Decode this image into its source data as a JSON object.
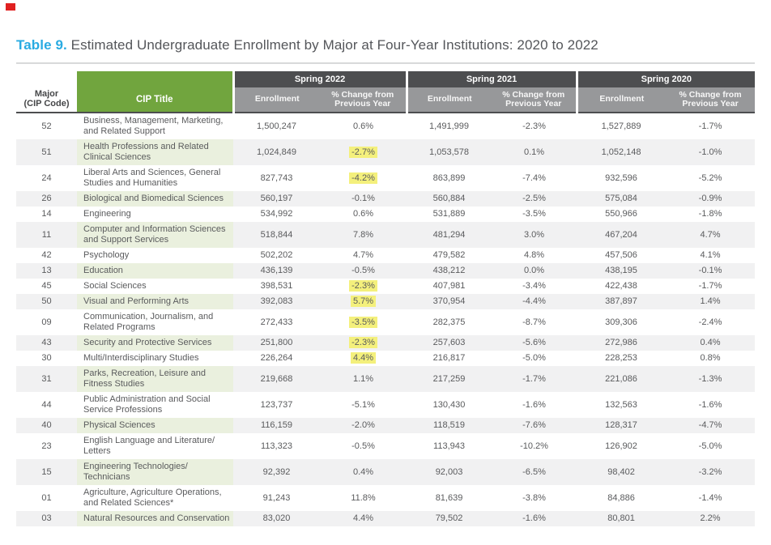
{
  "marker": {
    "color": "#e02020"
  },
  "title": {
    "prefix": "Table 9.",
    "text": " Estimated Undergraduate Enrollment by Major at Four-Year Institutions: 2020 to 2022"
  },
  "colors": {
    "accent_blue": "#29abe2",
    "header_green": "#71a53e",
    "band_dark_gray": "#4d4e50",
    "band_mid_gray": "#97989a",
    "row_tint_gray": "#f1f1f2",
    "row_tint_green": "#eaf0de",
    "highlight_yellow": "#f4f07c"
  },
  "table": {
    "headers": {
      "major_line1": "Major",
      "major_line2": "(CIP Code)",
      "cip_title": "CIP Title",
      "groups": [
        {
          "label": "Spring 2022"
        },
        {
          "label": "Spring 2021"
        },
        {
          "label": "Spring 2020"
        }
      ],
      "enrollment": "Enrollment",
      "pct_change_line1": "% Change from",
      "pct_change_line2": "Previous Year"
    },
    "rows": [
      {
        "code": "52",
        "title": "Business, Management, Marketing, and Related Support",
        "s2022": {
          "enrollment": "1,500,247",
          "change": "0.6%",
          "highlight": false
        },
        "s2021": {
          "enrollment": "1,491,999",
          "change": "-2.3%"
        },
        "s2020": {
          "enrollment": "1,527,889",
          "change": "-1.7%"
        }
      },
      {
        "code": "51",
        "title": "Health Professions and Related Clinical Sciences",
        "s2022": {
          "enrollment": "1,024,849",
          "change": "-2.7%",
          "highlight": true
        },
        "s2021": {
          "enrollment": "1,053,578",
          "change": "0.1%"
        },
        "s2020": {
          "enrollment": "1,052,148",
          "change": "-1.0%"
        }
      },
      {
        "code": "24",
        "title": "Liberal Arts and Sciences, General Studies and Humanities",
        "s2022": {
          "enrollment": "827,743",
          "change": "-4.2%",
          "highlight": true
        },
        "s2021": {
          "enrollment": "863,899",
          "change": "-7.4%"
        },
        "s2020": {
          "enrollment": "932,596",
          "change": "-5.2%"
        }
      },
      {
        "code": "26",
        "title": "Biological and Biomedical Sciences",
        "s2022": {
          "enrollment": "560,197",
          "change": "-0.1%",
          "highlight": false
        },
        "s2021": {
          "enrollment": "560,884",
          "change": "-2.5%"
        },
        "s2020": {
          "enrollment": "575,084",
          "change": "-0.9%"
        }
      },
      {
        "code": "14",
        "title": "Engineering",
        "s2022": {
          "enrollment": "534,992",
          "change": "0.6%",
          "highlight": false
        },
        "s2021": {
          "enrollment": "531,889",
          "change": "-3.5%"
        },
        "s2020": {
          "enrollment": "550,966",
          "change": "-1.8%"
        }
      },
      {
        "code": "11",
        "title": "Computer and Information Sciences and Support Services",
        "s2022": {
          "enrollment": "518,844",
          "change": "7.8%",
          "highlight": false
        },
        "s2021": {
          "enrollment": "481,294",
          "change": "3.0%"
        },
        "s2020": {
          "enrollment": "467,204",
          "change": "4.7%"
        }
      },
      {
        "code": "42",
        "title": "Psychology",
        "s2022": {
          "enrollment": "502,202",
          "change": "4.7%",
          "highlight": false
        },
        "s2021": {
          "enrollment": "479,582",
          "change": "4.8%"
        },
        "s2020": {
          "enrollment": "457,506",
          "change": "4.1%"
        }
      },
      {
        "code": "13",
        "title": "Education",
        "s2022": {
          "enrollment": "436,139",
          "change": "-0.5%",
          "highlight": false
        },
        "s2021": {
          "enrollment": "438,212",
          "change": "0.0%"
        },
        "s2020": {
          "enrollment": "438,195",
          "change": "-0.1%"
        }
      },
      {
        "code": "45",
        "title": "Social Sciences",
        "s2022": {
          "enrollment": "398,531",
          "change": "-2.3%",
          "highlight": true
        },
        "s2021": {
          "enrollment": "407,981",
          "change": "-3.4%"
        },
        "s2020": {
          "enrollment": "422,438",
          "change": "-1.7%"
        }
      },
      {
        "code": "50",
        "title": "Visual and Performing Arts",
        "s2022": {
          "enrollment": "392,083",
          "change": "5.7%",
          "highlight": true
        },
        "s2021": {
          "enrollment": "370,954",
          "change": "-4.4%"
        },
        "s2020": {
          "enrollment": "387,897",
          "change": "1.4%"
        }
      },
      {
        "code": "09",
        "title": "Communication, Journalism, and Related Programs",
        "s2022": {
          "enrollment": "272,433",
          "change": "-3.5%",
          "highlight": true
        },
        "s2021": {
          "enrollment": "282,375",
          "change": "-8.7%"
        },
        "s2020": {
          "enrollment": "309,306",
          "change": "-2.4%"
        }
      },
      {
        "code": "43",
        "title": "Security and Protective Services",
        "s2022": {
          "enrollment": "251,800",
          "change": "-2.3%",
          "highlight": true
        },
        "s2021": {
          "enrollment": "257,603",
          "change": "-5.6%"
        },
        "s2020": {
          "enrollment": "272,986",
          "change": "0.4%"
        }
      },
      {
        "code": "30",
        "title": "Multi/Interdisciplinary Studies",
        "s2022": {
          "enrollment": "226,264",
          "change": "4.4%",
          "highlight": true
        },
        "s2021": {
          "enrollment": "216,817",
          "change": "-5.0%"
        },
        "s2020": {
          "enrollment": "228,253",
          "change": "0.8%"
        }
      },
      {
        "code": "31",
        "title": "Parks, Recreation, Leisure and Fitness Studies",
        "s2022": {
          "enrollment": "219,668",
          "change": "1.1%",
          "highlight": false
        },
        "s2021": {
          "enrollment": "217,259",
          "change": "-1.7%"
        },
        "s2020": {
          "enrollment": "221,086",
          "change": "-1.3%"
        }
      },
      {
        "code": "44",
        "title": "Public Administration and Social Service Professions",
        "s2022": {
          "enrollment": "123,737",
          "change": "-5.1%",
          "highlight": false
        },
        "s2021": {
          "enrollment": "130,430",
          "change": "-1.6%"
        },
        "s2020": {
          "enrollment": "132,563",
          "change": "-1.6%"
        }
      },
      {
        "code": "40",
        "title": "Physical Sciences",
        "s2022": {
          "enrollment": "116,159",
          "change": "-2.0%",
          "highlight": false
        },
        "s2021": {
          "enrollment": "118,519",
          "change": "-7.6%"
        },
        "s2020": {
          "enrollment": "128,317",
          "change": "-4.7%"
        }
      },
      {
        "code": "23",
        "title": "English Language and Literature/Letters",
        "s2022": {
          "enrollment": "113,323",
          "change": "-0.5%",
          "highlight": false
        },
        "s2021": {
          "enrollment": "113,943",
          "change": "-10.2%"
        },
        "s2020": {
          "enrollment": "126,902",
          "change": "-5.0%"
        }
      },
      {
        "code": "15",
        "title": "Engineering Technologies/Technicians",
        "s2022": {
          "enrollment": "92,392",
          "change": "0.4%",
          "highlight": false
        },
        "s2021": {
          "enrollment": "92,003",
          "change": "-6.5%"
        },
        "s2020": {
          "enrollment": "98,402",
          "change": "-3.2%"
        }
      },
      {
        "code": "01",
        "title": "Agriculture, Agriculture Operations, and Related Sciences*",
        "s2022": {
          "enrollment": "91,243",
          "change": "11.8%",
          "highlight": false
        },
        "s2021": {
          "enrollment": "81,639",
          "change": "-3.8%"
        },
        "s2020": {
          "enrollment": "84,886",
          "change": "-1.4%"
        }
      },
      {
        "code": "03",
        "title": "Natural Resources and Conservation",
        "s2022": {
          "enrollment": "83,020",
          "change": "4.4%",
          "highlight": false
        },
        "s2021": {
          "enrollment": "79,502",
          "change": "-1.6%"
        },
        "s2020": {
          "enrollment": "80,801",
          "change": "2.2%"
        }
      }
    ]
  }
}
